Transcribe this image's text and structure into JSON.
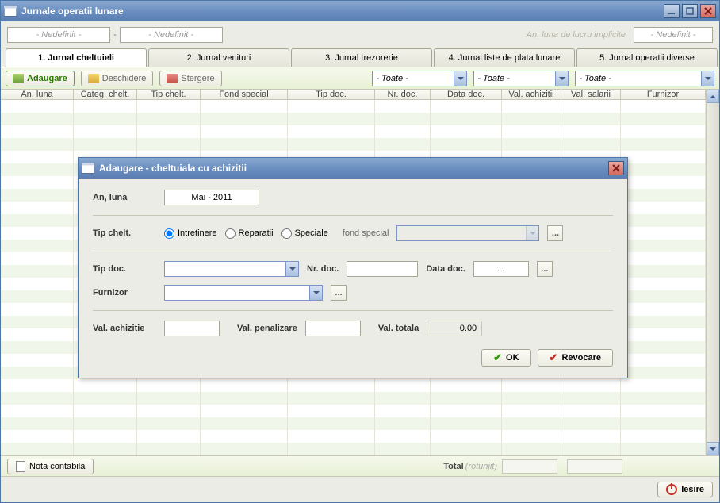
{
  "window": {
    "title": "Jurnale operatii lunare"
  },
  "topfilter": {
    "left1": "- Nedefinit -",
    "left2": "- Nedefinit -",
    "hint": "An, luna de lucru implicite",
    "right": "- Nedefinit -"
  },
  "tabs": [
    {
      "label": "1. Jurnal cheltuieli",
      "active": true
    },
    {
      "label": "2. Jurnal venituri",
      "active": false
    },
    {
      "label": "3. Jurnal trezorerie",
      "active": false
    },
    {
      "label": "4. Jurnal liste de plata lunare",
      "active": false
    },
    {
      "label": "5. Jurnal operatii diverse",
      "active": false
    }
  ],
  "toolbar": {
    "add": "Adaugare",
    "open": "Deschidere",
    "del": "Stergere",
    "filters": [
      "- Toate -",
      "- Toate -",
      "- Toate -"
    ]
  },
  "columns": [
    "An, luna",
    "Categ. chelt.",
    "Tip chelt.",
    "Fond special",
    "Tip doc.",
    "Nr. doc.",
    "Data doc.",
    "Val. achizitii",
    "Val. salarii",
    "Furnizor"
  ],
  "footer": {
    "nota": "Nota contabila",
    "total": "Total",
    "rotunjit": "(rotunjit)",
    "exit": "Iesire"
  },
  "dialog": {
    "title": "Adaugare - cheltuiala cu achizitii",
    "labels": {
      "anluna": "An, luna",
      "tipchelt": "Tip chelt.",
      "tipdoc": "Tip doc.",
      "nrdoc": "Nr. doc.",
      "datadoc": "Data doc.",
      "furnizor": "Furnizor",
      "valach": "Val. achizitie",
      "valpen": "Val. penalizare",
      "valtot": "Val. totala",
      "fondsp": "fond special"
    },
    "values": {
      "anluna": "Mai - 2011",
      "datadoc": ". .",
      "valtot": "0.00"
    },
    "radios": {
      "r1": "Intretinere",
      "r2": "Reparatii",
      "r3": "Speciale"
    },
    "buttons": {
      "ok": "OK",
      "cancel": "Revocare"
    }
  }
}
